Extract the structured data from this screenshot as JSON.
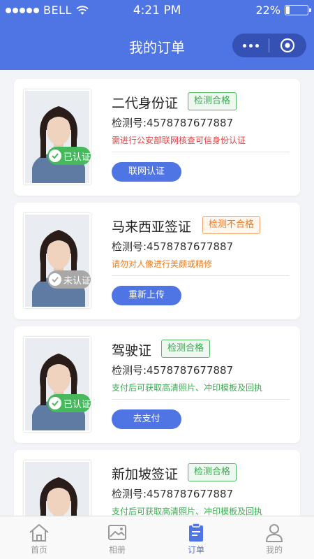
{
  "status_bar": {
    "carrier": "BELL",
    "time": "4:21 PM",
    "battery": "22%",
    "battery_level": 0.22
  },
  "nav": {
    "title": "我的订单",
    "more_icon": "more-dots-icon",
    "close_icon": "target-icon"
  },
  "orders": [
    {
      "title": "二代身份证",
      "status": "检测合格",
      "status_type": "pass",
      "number": "检测号:4578787677887",
      "note": "需进行公安部联网核查可信身份认证",
      "note_color": "#e54242",
      "badge": "已认证",
      "badge_type": "verified",
      "button": "联网认证"
    },
    {
      "title": "马来西亚签证",
      "status": "检测不合格",
      "status_type": "fail",
      "number": "检测号:4578787677887",
      "note": "请勿对人像进行美颜或精修",
      "note_color": "#f07a1a",
      "badge": "未认证",
      "badge_type": "unverified",
      "button": "重新上传"
    },
    {
      "title": "驾驶证",
      "status": "检测合格",
      "status_type": "pass",
      "number": "检测号:4578787677887",
      "note": "支付后可获取高清照片、冲印模板及回执",
      "note_color": "#3aad50",
      "badge": "已认证",
      "badge_type": "verified",
      "button": "去支付"
    },
    {
      "title": "新加坡签证",
      "status": "检测合格",
      "status_type": "pass",
      "number": "检测号:4578787677887",
      "note": "支付后可获取高清照片、冲印模板及回执",
      "note_color": "#3aad50"
    }
  ],
  "tabbar": [
    {
      "label": "首页",
      "icon": "home-icon",
      "active": false
    },
    {
      "label": "相册",
      "icon": "album-icon",
      "active": false
    },
    {
      "label": "订单",
      "icon": "order-icon",
      "active": true
    },
    {
      "label": "我的",
      "icon": "user-icon",
      "active": false
    }
  ],
  "colors": {
    "primary": "#4f74e3",
    "pass": "#37a74c",
    "fail": "#f07a1a",
    "background": "#f2f4f8"
  }
}
